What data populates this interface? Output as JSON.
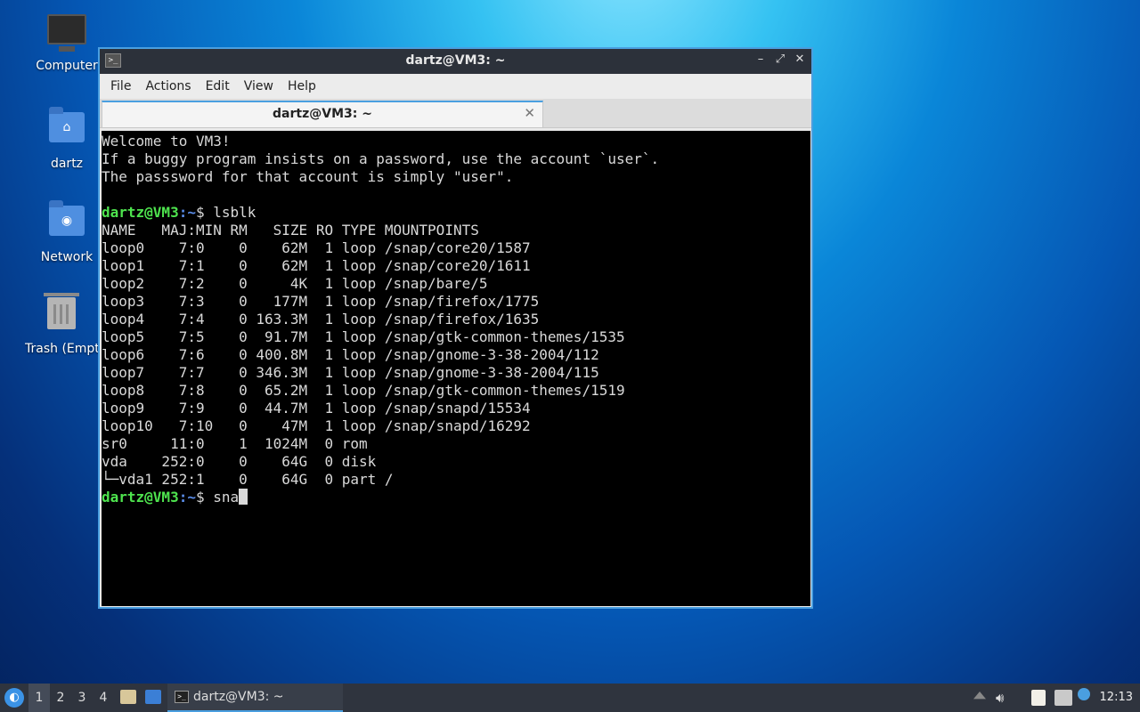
{
  "desktop": {
    "icons": [
      {
        "label": "Computer",
        "icon": "computer-icon"
      },
      {
        "label": "dartz",
        "icon": "home-folder-icon"
      },
      {
        "label": "Network",
        "icon": "network-folder-icon"
      },
      {
        "label": "Trash (Empty)",
        "icon": "trash-icon"
      }
    ]
  },
  "window": {
    "title": "dartz@VM3: ~",
    "controls": {
      "minimize": "–",
      "maximize": "⤢",
      "close": "✕"
    },
    "menu": [
      "File",
      "Actions",
      "Edit",
      "View",
      "Help"
    ],
    "tab": {
      "label": "dartz@VM3: ~",
      "close": "✕"
    }
  },
  "terminal": {
    "prompt_user": "dartz@VM3",
    "prompt_path": ":~",
    "prompt_symbol": "$ ",
    "welcome": [
      "Welcome to VM3!",
      "If a buggy program insists on a password, use the account `user`.",
      "The passsword for that account is simply \"user\".",
      ""
    ],
    "command1": "lsblk",
    "output": [
      "NAME   MAJ:MIN RM   SIZE RO TYPE MOUNTPOINTS",
      "loop0    7:0    0    62M  1 loop /snap/core20/1587",
      "loop1    7:1    0    62M  1 loop /snap/core20/1611",
      "loop2    7:2    0     4K  1 loop /snap/bare/5",
      "loop3    7:3    0   177M  1 loop /snap/firefox/1775",
      "loop4    7:4    0 163.3M  1 loop /snap/firefox/1635",
      "loop5    7:5    0  91.7M  1 loop /snap/gtk-common-themes/1535",
      "loop6    7:6    0 400.8M  1 loop /snap/gnome-3-38-2004/112",
      "loop7    7:7    0 346.3M  1 loop /snap/gnome-3-38-2004/115",
      "loop8    7:8    0  65.2M  1 loop /snap/gtk-common-themes/1519",
      "loop9    7:9    0  44.7M  1 loop /snap/snapd/15534",
      "loop10   7:10   0    47M  1 loop /snap/snapd/16292",
      "sr0     11:0    1  1024M  0 rom",
      "vda    252:0    0    64G  0 disk",
      "└─vda1 252:1    0    64G  0 part /"
    ],
    "current_input": "sna"
  },
  "taskbar": {
    "start_icon": "lubuntu-start-icon",
    "workspaces": [
      "1",
      "2",
      "3",
      "4"
    ],
    "active_workspace": "1",
    "task_label": "dartz@VM3: ~",
    "clock": "12:13"
  },
  "colors": {
    "prompt_user": "#4ee34e",
    "prompt_path": "#5a8ce8",
    "accent": "#4a9fe0",
    "titlebar": "#2c313a"
  }
}
